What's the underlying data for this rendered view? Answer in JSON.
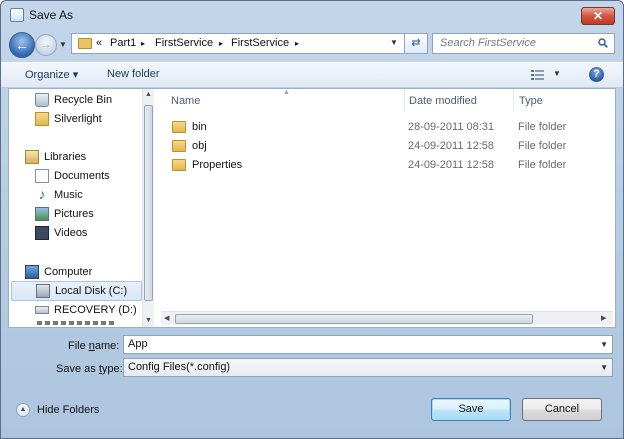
{
  "window": {
    "title": "Save As",
    "close_label": "✕"
  },
  "address": {
    "overflow_glyph": "«",
    "crumbs": [
      "Part1",
      "FirstService",
      "FirstService"
    ],
    "separator": "▸"
  },
  "search": {
    "placeholder": "Search FirstService"
  },
  "toolbar": {
    "organize": "Organize ▾",
    "new_folder": "New folder",
    "help": "?"
  },
  "nav": {
    "recycle_bin": "Recycle Bin",
    "silverlight": "Silverlight",
    "libraries": "Libraries",
    "documents": "Documents",
    "music": "Music",
    "pictures": "Pictures",
    "videos": "Videos",
    "computer": "Computer",
    "local_disk": "Local Disk (C:)",
    "recovery": "RECOVERY (D:)"
  },
  "columns": {
    "name": "Name",
    "date_modified": "Date modified",
    "type": "Type"
  },
  "files": [
    {
      "name": "bin",
      "date": "28-09-2011 08:31",
      "type": "File folder"
    },
    {
      "name": "obj",
      "date": "24-09-2011 12:58",
      "type": "File folder"
    },
    {
      "name": "Properties",
      "date": "24-09-2011 12:58",
      "type": "File folder"
    }
  ],
  "form": {
    "file_name_label_pre": "File ",
    "file_name_label_key": "n",
    "file_name_label_post": "ame:",
    "file_name_value": "App",
    "save_type_label_pre": "Save as ",
    "save_type_label_key": "t",
    "save_type_label_post": "ype:",
    "save_type_value": "Config Files(*.config)"
  },
  "footer": {
    "hide_folders": "Hide Folders",
    "save": "Save",
    "cancel": "Cancel"
  },
  "colors": {
    "accent": "#3c7fb1",
    "close": "#c43a22",
    "folder": "#e2b84e"
  }
}
